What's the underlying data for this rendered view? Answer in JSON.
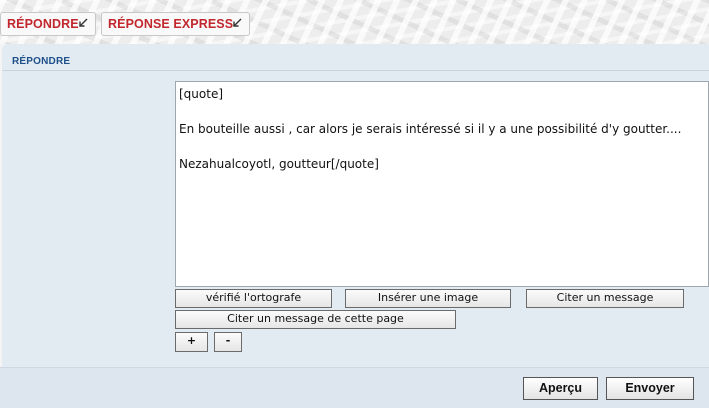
{
  "toolbar": {
    "reply_label": "RÉPONDRE",
    "quick_reply_label": "RÉPONSE EXPRESS",
    "reply_icon": "arrow-down-left-icon",
    "quick_reply_icon": "arrow-down-left-icon"
  },
  "form": {
    "title": "RÉPONDRE",
    "message_value": "[quote]\n\nEn bouteille aussi , car alors je serais intéressé si il y a une possibilité d'y goutter....\n\nNezahualcoyotl, goutteur[/quote]"
  },
  "editor_buttons": {
    "spellcheck": "vérifié l'ortografe",
    "insert_image": "Insérer une image",
    "quote_message": "Citer un message",
    "quote_from_page": "Citer un message de cette page",
    "enlarge": "+",
    "shrink": "-"
  },
  "actions": {
    "preview": "Aperçu",
    "send": "Envoyer"
  },
  "colors": {
    "accent_red": "#c1272d",
    "title_blue": "#1d4f8a",
    "panel_bg": "#e3ebf2"
  }
}
